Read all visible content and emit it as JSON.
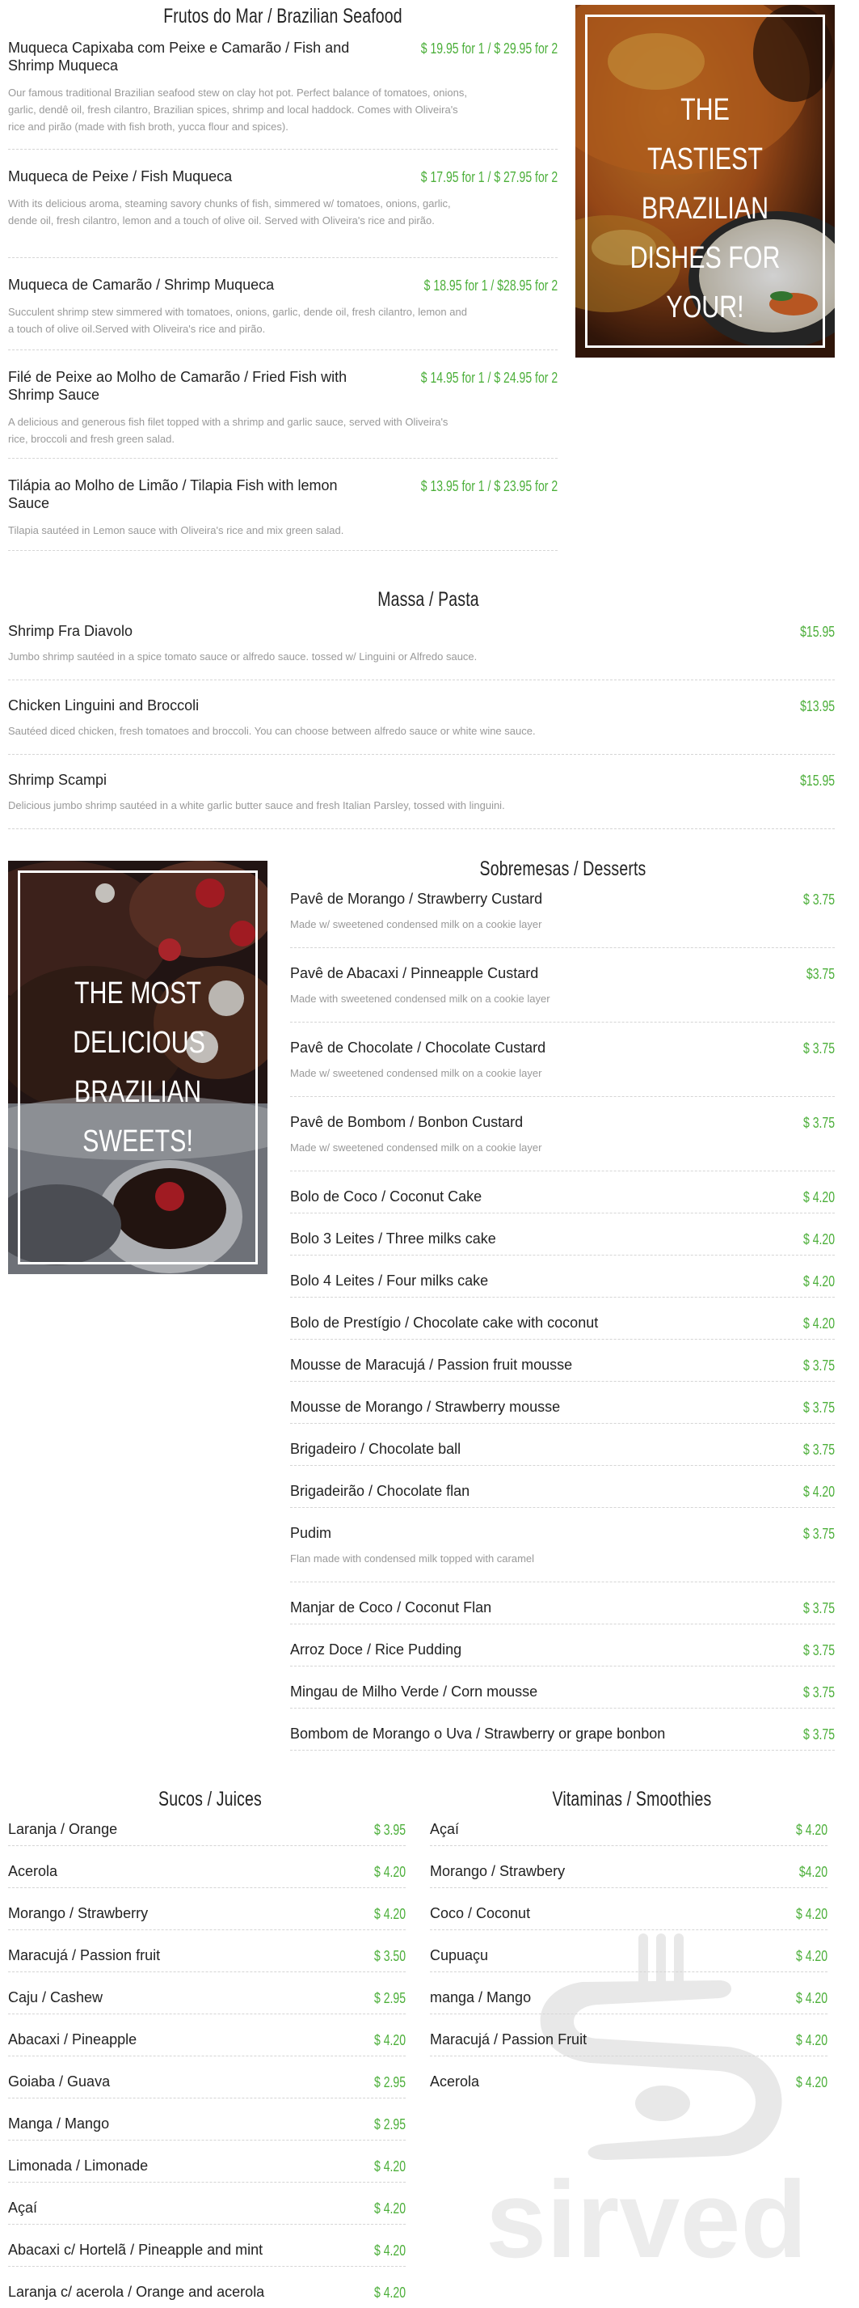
{
  "seafood": {
    "title": "Frutos do Mar / Brazilian Seafood",
    "items": [
      {
        "name": "Muqueca Capixaba com Peixe e Camarão / Fish and Shrimp Muqueca",
        "price": "$ 19.95 for 1 / $ 29.95 for 2",
        "desc": "Our famous traditional Brazilian seafood stew on clay hot pot. Perfect balance of tomatoes, onions, garlic, dendê oil, fresh cilantro, Brazilian spices, shrimp and local haddock. Comes with Oliveira's rice and pirão (made with fish broth, yucca flour and spices)."
      },
      {
        "name": "Muqueca de Peixe / Fish Muqueca",
        "price": "$ 17.95 for 1 / $ 27.95 for 2",
        "desc": "With its delicious aroma, steaming savory chunks of fish, simmered w/ tomatoes, onions, garlic, dende oil, fresh cilantro, lemon and a touch of olive oil. Served with Oliveira's rice and pirão."
      },
      {
        "name": "Muqueca de Camarão / Shrimp Muqueca",
        "price": "$ 18.95 for 1 / $28.95 for 2",
        "desc": "Succulent shrimp stew simmered with tomatoes, onions, garlic, dende oil, fresh cilantro, lemon and a touch of olive oil.Served with Oliveira's rice and pirão."
      },
      {
        "name": "Filé de Peixe ao Molho de Camarão / Fried Fish with Shrimp Sauce",
        "price": "$ 14.95 for 1 / $ 24.95 for 2",
        "desc": "A delicious and generous fish filet topped with a shrimp and garlic sauce, served with Oliveira's rice, broccoli and fresh green salad."
      },
      {
        "name": "Tilápia ao Molho de Limão / Tilapia Fish with lemon Sauce",
        "price": "$ 13.95 for 1 / $ 23.95 for 2",
        "desc": "Tilapia sautéed in Lemon sauce with Oliveira's rice and mix green salad."
      }
    ]
  },
  "promo1": {
    "text": "THE TASTIEST BRAZILIAN DISHES FOR YOUR!"
  },
  "pasta": {
    "title": "Massa / Pasta",
    "items": [
      {
        "name": "Shrimp Fra Diavolo",
        "price": "$15.95",
        "desc": "Jumbo shrimp sautéed in a spice tomato sauce or alfredo sauce. tossed w/ Linguini or Alfredo sauce."
      },
      {
        "name": "Chicken Linguini and Broccoli",
        "price": "$13.95",
        "desc": "Sautéed diced chicken, fresh tomatoes and broccoli. You can choose between alfredo sauce or white wine sauce."
      },
      {
        "name": "Shrimp Scampi",
        "price": "$15.95",
        "desc": "Delicious jumbo shrimp sautéed in a white garlic butter sauce and fresh Italian Parsley, tossed with linguini."
      }
    ]
  },
  "promo2": {
    "text": "THE MOST DELICIOUS BRAZILIAN SWEETS!"
  },
  "desserts": {
    "title": "Sobremesas / Desserts",
    "items": [
      {
        "name": "Pavê de Morango / Strawberry Custard",
        "price": "$ 3.75",
        "desc": "Made w/ sweetened condensed milk on a cookie layer"
      },
      {
        "name": "Pavê de Abacaxi / Pinneapple Custard",
        "price": "$3.75",
        "desc": "Made with sweetened condensed milk on a cookie layer"
      },
      {
        "name": "Pavê de Chocolate / Chocolate Custard",
        "price": "$ 3.75",
        "desc": "Made w/ sweetened condensed milk on a cookie layer"
      },
      {
        "name": "Pavê de Bombom / Bonbon Custard",
        "price": "$ 3.75",
        "desc": "Made w/ sweetened condensed milk on a cookie layer"
      },
      {
        "name": "Bolo de Coco / Coconut Cake",
        "price": "$ 4.20",
        "desc": ""
      },
      {
        "name": "Bolo 3 Leites / Three milks cake",
        "price": "$ 4.20",
        "desc": ""
      },
      {
        "name": "Bolo 4 Leites / Four milks cake",
        "price": "$ 4.20",
        "desc": ""
      },
      {
        "name": "Bolo de Prestígio / Chocolate cake with coconut",
        "price": "$ 4.20",
        "desc": ""
      },
      {
        "name": "Mousse de Maracujá / Passion fruit mousse",
        "price": "$ 3.75",
        "desc": ""
      },
      {
        "name": "Mousse de Morango / Strawberry mousse",
        "price": "$ 3.75",
        "desc": ""
      },
      {
        "name": "Brigadeiro / Chocolate ball",
        "price": "$ 3.75",
        "desc": ""
      },
      {
        "name": "Brigadeirão / Chocolate flan",
        "price": "$ 4.20",
        "desc": ""
      },
      {
        "name": "Pudim",
        "price": "$ 3.75",
        "desc": "Flan made with condensed milk topped with caramel"
      },
      {
        "name": "Manjar de Coco / Coconut Flan",
        "price": "$ 3.75",
        "desc": ""
      },
      {
        "name": "Arroz Doce / Rice Pudding",
        "price": "$ 3.75",
        "desc": ""
      },
      {
        "name": "Mingau de Milho Verde / Corn mousse",
        "price": "$ 3.75",
        "desc": ""
      },
      {
        "name": "Bombom de Morango o Uva / Strawberry or grape bonbon",
        "price": "$ 3.75",
        "desc": ""
      }
    ]
  },
  "juices": {
    "title": "Sucos / Juices",
    "items": [
      {
        "name": "Laranja / Orange",
        "price": "$ 3.95"
      },
      {
        "name": "Acerola",
        "price": "$ 4.20"
      },
      {
        "name": "Morango / Strawberry",
        "price": "$ 4.20"
      },
      {
        "name": "Maracujá / Passion fruit",
        "price": "$ 3.50"
      },
      {
        "name": "Caju / Cashew",
        "price": "$ 2.95"
      },
      {
        "name": "Abacaxi / Pineapple",
        "price": "$ 4.20"
      },
      {
        "name": "Goiaba / Guava",
        "price": "$ 2.95"
      },
      {
        "name": "Manga / Mango",
        "price": "$ 2.95"
      },
      {
        "name": "Limonada / Limonade",
        "price": "$ 4.20"
      },
      {
        "name": "Açaí",
        "price": "$ 4.20"
      },
      {
        "name": "Abacaxi c/ Hortelã / Pineapple and mint",
        "price": "$ 4.20"
      },
      {
        "name": "Laranja c/ acerola / Orange and acerola",
        "price": "$ 4.20"
      }
    ]
  },
  "smoothies": {
    "title": "Vitaminas / Smoothies",
    "items": [
      {
        "name": "Açaí",
        "price": "$ 4.20"
      },
      {
        "name": "Morango / Strawbery",
        "price": "$4.20"
      },
      {
        "name": "Coco / Coconut",
        "price": "$ 4.20"
      },
      {
        "name": "Cupuaçu",
        "price": "$ 4.20"
      },
      {
        "name": "manga / Mango",
        "price": "$ 4.20"
      },
      {
        "name": "Maracujá / Passion Fruit",
        "price": "$ 4.20"
      },
      {
        "name": "Acerola",
        "price": "$ 4.20"
      }
    ]
  },
  "watermark": {
    "text": "sirved"
  },
  "colors": {
    "price": "#4caf3a",
    "text": "#222222",
    "desc": "#999999"
  }
}
